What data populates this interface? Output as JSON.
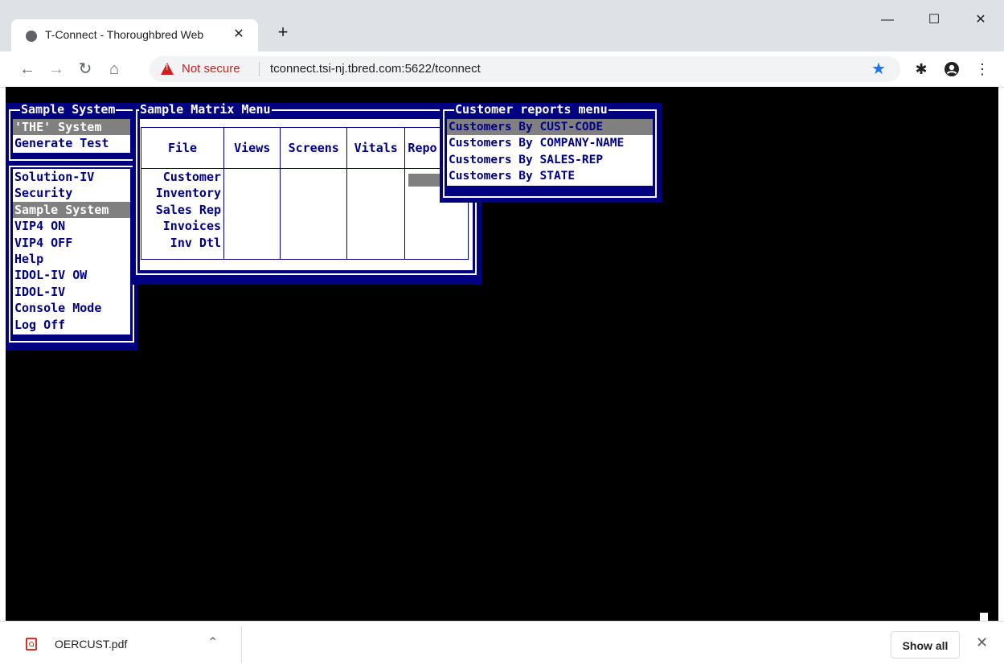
{
  "browser": {
    "tab_title": "T-Connect - Thoroughbred Web",
    "tab_close": "✕",
    "new_tab": "+",
    "not_secure": "Not secure",
    "url": "tconnect.tsi-nj.tbred.com:5622/tconnect",
    "window_minimize": "—",
    "window_maximize": "☐",
    "window_close": "✕"
  },
  "terminal": {
    "sample_system_window": {
      "title": "Sample System",
      "top_items": [
        "'THE' System",
        "Generate Test"
      ],
      "top_selected": 0,
      "menu_items": [
        "Solution-IV",
        "Security",
        "Sample System",
        "VIP4 ON",
        "VIP4 OFF",
        "Help",
        "IDOL-IV OW",
        "IDOL-IV",
        "Console Mode",
        "Log Off"
      ],
      "menu_selected": 2
    },
    "matrix_window": {
      "title": "Sample Matrix Menu",
      "columns": [
        "File",
        "Views",
        "Screens",
        "Vitals",
        "Repo"
      ],
      "rows": [
        "Customer",
        "Inventory",
        "Sales Rep",
        "Invoices",
        "Inv Dtl"
      ]
    },
    "customer_reports_window": {
      "title": "Customer reports menu",
      "items": [
        "Customers By CUST-CODE",
        "Customers By COMPANY-NAME",
        "Customers By SALES-REP",
        "Customers By STATE"
      ],
      "selected": 0
    }
  },
  "download_bar": {
    "file_name": "OERCUST.pdf",
    "show_all": "Show all"
  },
  "colors": {
    "terminal_bg": "#000000",
    "window_bg": "#000080",
    "list_bg": "#ffffff",
    "list_text": "#000080",
    "highlight": "#808080",
    "not_secure": "#c5221f",
    "star": "#1a73e8"
  },
  "icons": [
    "back-icon",
    "forward-icon",
    "reload-icon",
    "home-icon",
    "warning-icon",
    "star-icon",
    "extensions-icon",
    "profile-icon",
    "menu-icon",
    "pdf-icon",
    "chevron-up-icon",
    "close-icon"
  ]
}
